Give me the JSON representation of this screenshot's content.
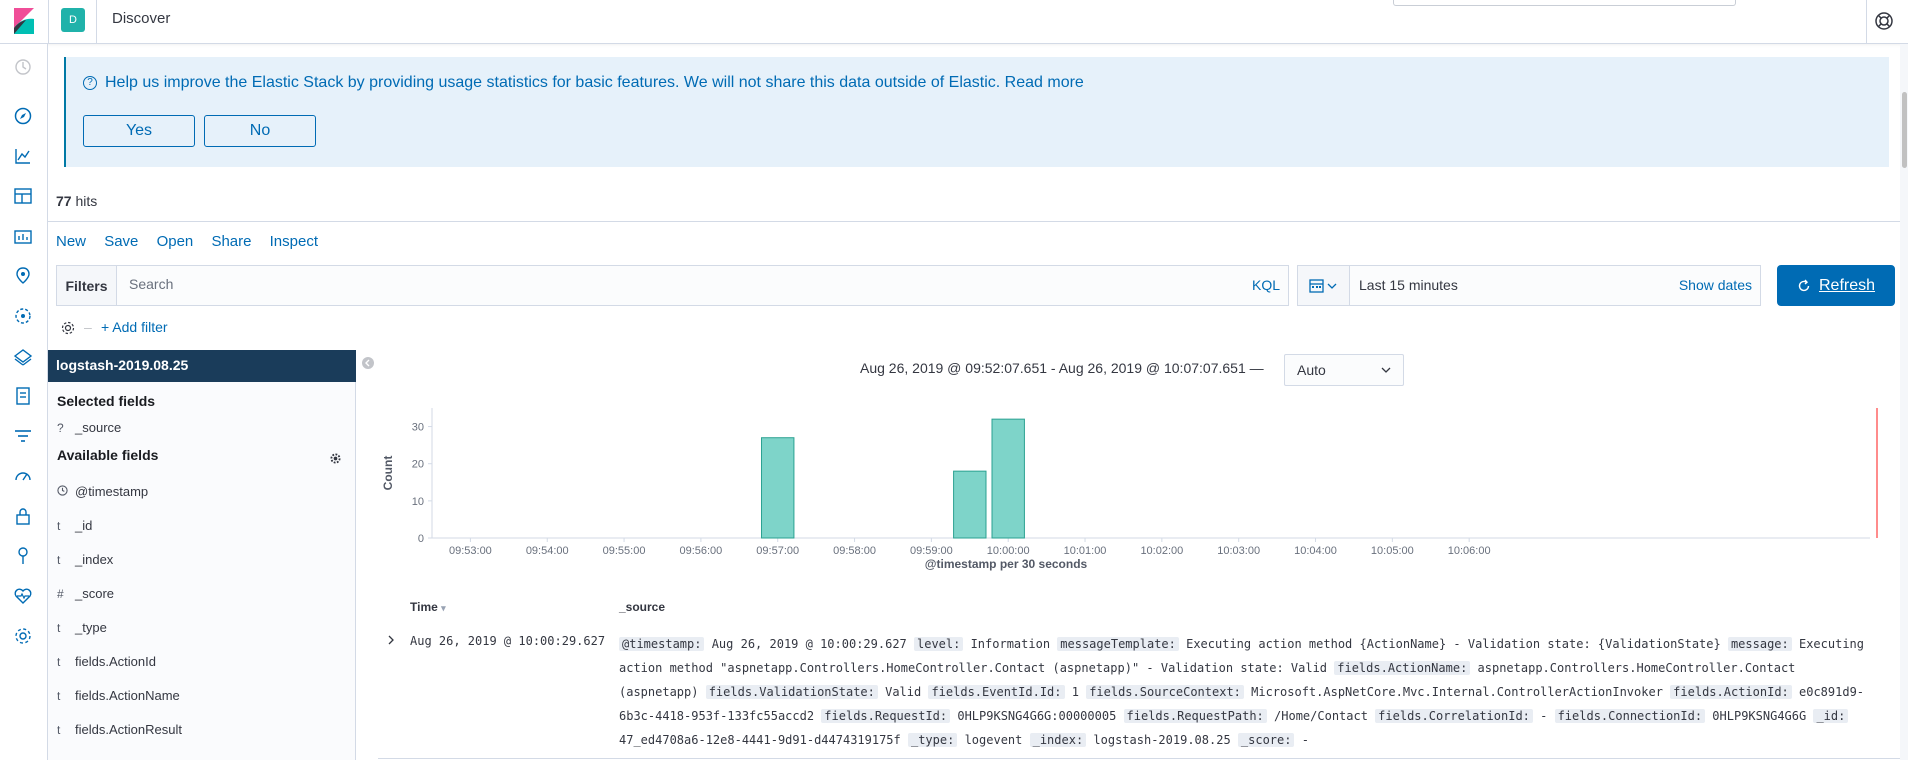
{
  "header": {
    "space_initial": "D",
    "breadcrumb": "Discover"
  },
  "callout": {
    "title": "Help us improve the Elastic Stack by providing usage statistics for basic features. We will not share this data outside of Elastic. Read more",
    "yes_label": "Yes",
    "no_label": "No"
  },
  "hits": {
    "count": "77",
    "label": "hits"
  },
  "menu": [
    "New",
    "Save",
    "Open",
    "Share",
    "Inspect"
  ],
  "query": {
    "filters_label": "Filters",
    "placeholder": "Search",
    "language": "KQL"
  },
  "date": {
    "label": "Last 15 minutes",
    "show_dates": "Show dates",
    "refresh_label": "Refresh"
  },
  "filter_row": {
    "add_filter": "+ Add filter"
  },
  "sidebar": {
    "index_pattern": "logstash-2019.08.25",
    "selected_title": "Selected fields",
    "selected_fields": [
      {
        "type": "?",
        "name": "_source"
      }
    ],
    "available_title": "Available fields",
    "available_fields": [
      {
        "type": "clock",
        "name": "@timestamp"
      },
      {
        "type": "t",
        "name": "_id"
      },
      {
        "type": "t",
        "name": "_index"
      },
      {
        "type": "#",
        "name": "_score"
      },
      {
        "type": "t",
        "name": "_type"
      },
      {
        "type": "t",
        "name": "fields.ActionId"
      },
      {
        "type": "t",
        "name": "fields.ActionName"
      },
      {
        "type": "t",
        "name": "fields.ActionResult"
      }
    ]
  },
  "histogram": {
    "time_range": "Aug 26, 2019 @ 09:52:07.651 - Aug 26, 2019 @ 10:07:07.651 —",
    "interval": "Auto"
  },
  "chart_data": {
    "type": "bar",
    "categories": [
      "09:57:00",
      "09:59:30",
      "10:00:00"
    ],
    "values": [
      27,
      18,
      32
    ],
    "x_ticks": [
      "09:53:00",
      "09:54:00",
      "09:55:00",
      "09:56:00",
      "09:57:00",
      "09:58:00",
      "09:59:00",
      "10:00:00",
      "10:01:00",
      "10:02:00",
      "10:03:00",
      "10:04:00",
      "10:05:00",
      "10:06:00"
    ],
    "y_ticks": [
      0,
      10,
      20,
      30
    ],
    "xlabel": "@timestamp per 30 seconds",
    "ylabel": "Count",
    "ylim": [
      0,
      35
    ],
    "bar_color": "#54b399",
    "grid": false
  },
  "table": {
    "col_time": "Time",
    "col_source": "_source",
    "rows": [
      {
        "time": "Aug 26, 2019 @ 10:00:29.627",
        "source": [
          {
            "k": "@timestamp:",
            "v": "Aug 26, 2019 @ 10:00:29.627"
          },
          {
            "k": "level:",
            "v": "Information"
          },
          {
            "k": "messageTemplate:",
            "v": "Executing action method {ActionName} - Validation state: {ValidationState}"
          },
          {
            "k": "message:",
            "v": "Executing action method \"aspnetapp.Controllers.HomeController.Contact (aspnetapp)\" - Validation state: Valid"
          },
          {
            "k": "fields.ActionName:",
            "v": "aspnetapp.Controllers.HomeController.Contact (aspnetapp)"
          },
          {
            "k": "fields.ValidationState:",
            "v": "Valid"
          },
          {
            "k": "fields.EventId.Id:",
            "v": "1"
          },
          {
            "k": "fields.SourceContext:",
            "v": "Microsoft.AspNetCore.Mvc.Internal.ControllerActionInvoker"
          },
          {
            "k": "fields.ActionId:",
            "v": "e0c891d9-6b3c-4418-953f-133fc55accd2"
          },
          {
            "k": "fields.RequestId:",
            "v": "0HLP9KSNG4G6G:00000005"
          },
          {
            "k": "fields.RequestPath:",
            "v": "/Home/Contact"
          },
          {
            "k": "fields.CorrelationId:",
            "v": " -"
          },
          {
            "k": "fields.ConnectionId:",
            "v": "0HLP9KSNG4G6G"
          },
          {
            "k": "_id:",
            "v": "47_ed4708a6-12e8-4441-9d91-d4474319175f"
          },
          {
            "k": "_type:",
            "v": "logevent"
          },
          {
            "k": "_index:",
            "v": "logstash-2019.08.25"
          },
          {
            "k": "_score:",
            "v": " -"
          }
        ]
      }
    ]
  },
  "colors": {
    "primary": "#006bb4",
    "bar": "#54b399",
    "index_header": "#1a3c5a",
    "callout_bg": "#e6f1fa"
  }
}
